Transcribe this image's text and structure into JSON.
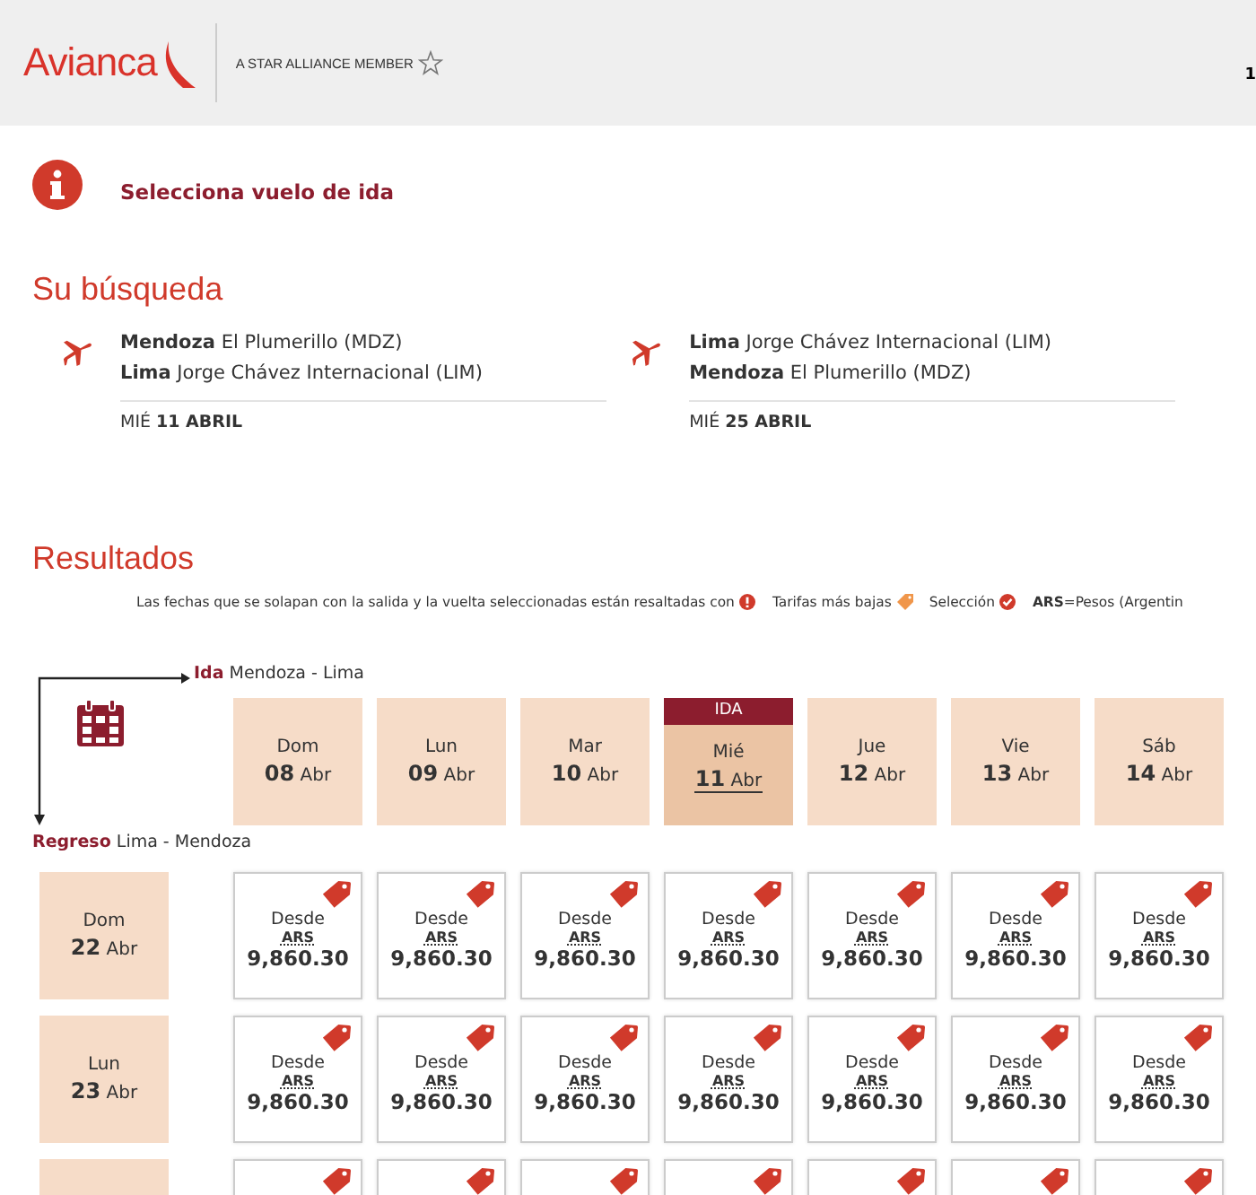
{
  "header": {
    "logo": "Avianca",
    "alliance": "A STAR ALLIANCE MEMBER",
    "corner": "1"
  },
  "notice": "Selecciona vuelo de ida",
  "search": {
    "title": "Su búsqueda",
    "legs": [
      {
        "from_city": "Mendoza",
        "from_airport": "El Plumerillo (MDZ)",
        "to_city": "Lima",
        "to_airport": "Jorge Chávez Internacional (LIM)",
        "weekday": "MIÉ",
        "date": "11 ABRIL"
      },
      {
        "from_city": "Lima",
        "from_airport": "Jorge Chávez Internacional (LIM)",
        "to_city": "Mendoza",
        "to_airport": "El Plumerillo (MDZ)",
        "weekday": "MIÉ",
        "date": "25 ABRIL"
      }
    ]
  },
  "results": {
    "title": "Resultados",
    "legend": [
      {
        "kind": "overlap",
        "text": "Las fechas que se solapan con la salida y la vuelta seleccionadas están resaltadas con"
      },
      {
        "kind": "lowest",
        "text": "Tarifas más bajas"
      },
      {
        "kind": "selection",
        "text": "Selección"
      },
      {
        "kind": "currency",
        "code": "ARS",
        "text": "=Pesos (Argentin"
      }
    ],
    "outbound": {
      "label": "Ida",
      "route": "Mendoza - Lima"
    },
    "return": {
      "label": "Regreso",
      "route": "Lima - Mendoza"
    },
    "selected_badge": "IDA",
    "dates": [
      {
        "weekday": "Dom",
        "day": "08",
        "month": "Abr",
        "selected": false
      },
      {
        "weekday": "Lun",
        "day": "09",
        "month": "Abr",
        "selected": false
      },
      {
        "weekday": "Mar",
        "day": "10",
        "month": "Abr",
        "selected": false
      },
      {
        "weekday": "Mié",
        "day": "11",
        "month": "Abr",
        "selected": true
      },
      {
        "weekday": "Jue",
        "day": "12",
        "month": "Abr",
        "selected": false
      },
      {
        "weekday": "Vie",
        "day": "13",
        "month": "Abr",
        "selected": false
      },
      {
        "weekday": "Sáb",
        "day": "14",
        "month": "Abr",
        "selected": false
      }
    ],
    "rows": [
      {
        "weekday": "Dom",
        "day": "22",
        "month": "Abr",
        "cells": [
          {
            "label": "Desde",
            "currency": "ARS",
            "price": "9,860.30",
            "lowest": true
          },
          {
            "label": "Desde",
            "currency": "ARS",
            "price": "9,860.30",
            "lowest": true
          },
          {
            "label": "Desde",
            "currency": "ARS",
            "price": "9,860.30",
            "lowest": true
          },
          {
            "label": "Desde",
            "currency": "ARS",
            "price": "9,860.30",
            "lowest": true
          },
          {
            "label": "Desde",
            "currency": "ARS",
            "price": "9,860.30",
            "lowest": true
          },
          {
            "label": "Desde",
            "currency": "ARS",
            "price": "9,860.30",
            "lowest": true
          },
          {
            "label": "Desde",
            "currency": "ARS",
            "price": "9,860.30",
            "lowest": true
          }
        ]
      },
      {
        "weekday": "Lun",
        "day": "23",
        "month": "Abr",
        "cells": [
          {
            "label": "Desde",
            "currency": "ARS",
            "price": "9,860.30",
            "lowest": true
          },
          {
            "label": "Desde",
            "currency": "ARS",
            "price": "9,860.30",
            "lowest": true
          },
          {
            "label": "Desde",
            "currency": "ARS",
            "price": "9,860.30",
            "lowest": true
          },
          {
            "label": "Desde",
            "currency": "ARS",
            "price": "9,860.30",
            "lowest": true
          },
          {
            "label": "Desde",
            "currency": "ARS",
            "price": "9,860.30",
            "lowest": true
          },
          {
            "label": "Desde",
            "currency": "ARS",
            "price": "9,860.30",
            "lowest": true
          },
          {
            "label": "Desde",
            "currency": "ARS",
            "price": "9,860.30",
            "lowest": true
          }
        ]
      },
      {
        "cells": [
          {
            "lowest": true
          },
          {
            "lowest": true
          },
          {
            "lowest": true
          },
          {
            "lowest": true
          },
          {
            "lowest": true
          },
          {
            "lowest": true
          },
          {
            "lowest": true
          }
        ]
      }
    ]
  }
}
